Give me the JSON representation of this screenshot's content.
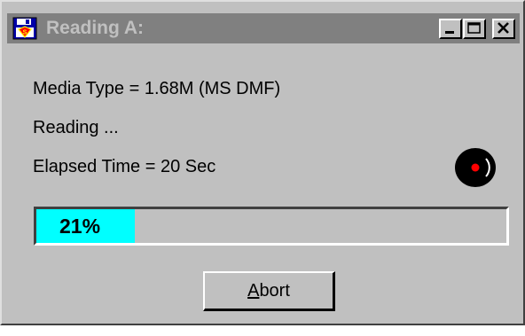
{
  "window": {
    "title": "Reading A:",
    "app_icon": "floppy-disk-icon",
    "controls": {
      "minimize": "minimize-icon",
      "maximize": "maximize-icon",
      "close": "close-icon"
    }
  },
  "status": {
    "media_type": "Media Type = 1.68M (MS DMF)",
    "reading": "Reading ...",
    "elapsed_time": "Elapsed Time =  20 Sec"
  },
  "activity_icon": "spinning-disk-icon",
  "progress": {
    "percent": 21,
    "label": "21%",
    "fill_color": "#00ffff"
  },
  "buttons": {
    "abort": {
      "accelerator": "A",
      "label_rest": "bort"
    }
  },
  "colors": {
    "face": "#c0c0c0",
    "titlebar_inactive": "#808080",
    "disk": "#000000",
    "disk_center": "#ff0000"
  }
}
